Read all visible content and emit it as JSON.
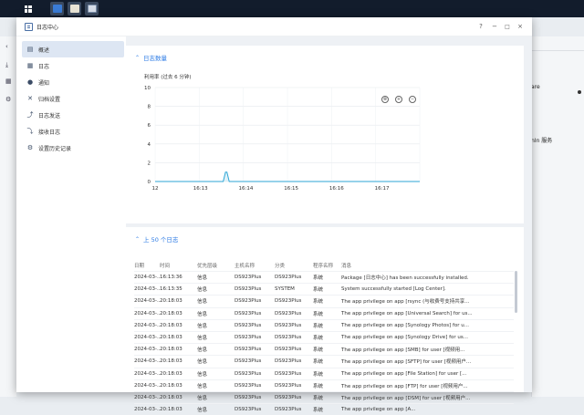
{
  "window": {
    "title": "日志中心",
    "help": "?",
    "minimize": "−",
    "maximize": "□",
    "close": "×"
  },
  "sidebar": {
    "items": [
      {
        "label": "概述",
        "icon": "overview-icon",
        "glyph": "▤"
      },
      {
        "label": "日志",
        "icon": "log-icon",
        "glyph": "▦"
      },
      {
        "label": "通知",
        "icon": "notification-icon",
        "glyph": "●"
      },
      {
        "label": "归档设置",
        "icon": "archive-settings-icon",
        "glyph": "✕"
      },
      {
        "label": "日志发送",
        "icon": "log-sending-icon",
        "glyph": "⤴"
      },
      {
        "label": "接收日志",
        "icon": "receive-logs-icon",
        "glyph": "⤵"
      },
      {
        "label": "设置历史记录",
        "icon": "settings-history-icon",
        "glyph": "⚙"
      }
    ]
  },
  "chart_panel": {
    "title": "日志数量",
    "subtitle": "利用率 (过去 6 分钟)",
    "zoom_icons": [
      "reset-zoom-icon",
      "zoom-in-icon",
      "zoom-out-icon"
    ]
  },
  "chart_data": {
    "type": "area",
    "title": "日志数量",
    "subtitle": "利用率 (过去 6 分钟)",
    "ylim": [
      0,
      10
    ],
    "yticks": [
      "0",
      "2",
      "4",
      "6",
      "8",
      "10"
    ],
    "xticks": [
      "12",
      "16:13",
      "16:14",
      "16:15",
      "16:16",
      "16:17"
    ],
    "x": [
      "16:12:00",
      "16:13:30",
      "16:13:33",
      "16:13:35",
      "16:13:38",
      "16:13:40",
      "16:17:50"
    ],
    "values": [
      0,
      0,
      1,
      1,
      0,
      0,
      0
    ],
    "color": "#2ea6d6",
    "grid": true
  },
  "logs_panel": {
    "title": "上 50 个日志",
    "columns": [
      "日期",
      "时间",
      "优先层级",
      "主机名称",
      "分类",
      "程序名称",
      "消息"
    ],
    "rows": [
      [
        "2024-03-...",
        "16:13:36",
        "信息",
        "DS923Plus",
        "DS923Plus",
        "系统",
        "Package [日志中心] has been successfully installed."
      ],
      [
        "2024-03-...",
        "16:13:35",
        "信息",
        "DS923Plus",
        "SYSTEM",
        "系统",
        "System successfully started [Log Center]."
      ],
      [
        "2024-03-...",
        "20:18:03",
        "信息",
        "DS923Plus",
        "DS923Plus",
        "系统",
        "The app privilege on app [rsync (与收费号支持共享..."
      ],
      [
        "2024-03-...",
        "20:18:03",
        "信息",
        "DS923Plus",
        "DS923Plus",
        "系统",
        "The app privilege on app [Universal Search] for us..."
      ],
      [
        "2024-03-...",
        "20:18:03",
        "信息",
        "DS923Plus",
        "DS923Plus",
        "系统",
        "The app privilege on app [Synology Photos] for u..."
      ],
      [
        "2024-03-...",
        "20:18:03",
        "信息",
        "DS923Plus",
        "DS923Plus",
        "系统",
        "The app privilege on app [Synology Drive] for us..."
      ],
      [
        "2024-03-...",
        "20:18:03",
        "信息",
        "DS923Plus",
        "DS923Plus",
        "系统",
        "The app privilege on app [SMB] for user [视频用..."
      ],
      [
        "2024-03-...",
        "20:18:03",
        "信息",
        "DS923Plus",
        "DS923Plus",
        "系统",
        "The app privilege on app [SFTP] for user [视频用户..."
      ],
      [
        "2024-03-...",
        "20:18:03",
        "信息",
        "DS923Plus",
        "DS923Plus",
        "系统",
        "The app privilege on app [File Station] for user [..."
      ],
      [
        "2024-03-...",
        "20:18:03",
        "信息",
        "DS923Plus",
        "DS923Plus",
        "系统",
        "The app privilege on app [FTP] for user [视频用户..."
      ],
      [
        "2024-03-...",
        "20:18:03",
        "信息",
        "DS923Plus",
        "DS923Plus",
        "系统",
        "The app privilege on app [DSM] for user [视频用户..."
      ],
      [
        "2024-03-...",
        "20:18:03",
        "信息",
        "DS923Plus",
        "DS923Plus",
        "系统",
        "The app privilege on app [A..."
      ]
    ]
  },
  "desktop": {
    "right_texts": [
      "are",
      "nIn 服务"
    ]
  }
}
